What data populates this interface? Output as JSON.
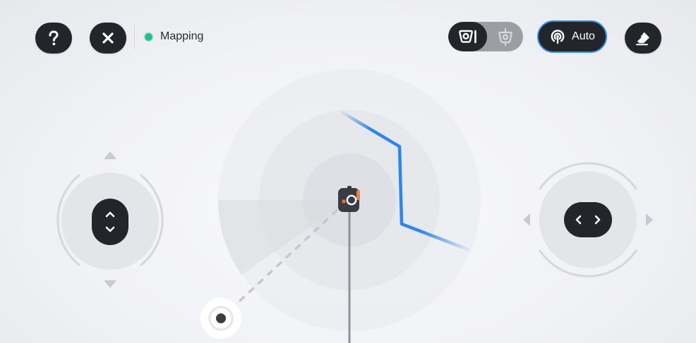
{
  "toolbar": {
    "help_icon": "question-mark-icon",
    "close_icon": "close-icon",
    "status": {
      "label": "Mapping",
      "color": "#22c08c"
    },
    "camera_toggle": {
      "active": "camera-icon",
      "inactive": "robot-icon"
    },
    "mode_button": {
      "label": "Auto",
      "icon": "signal-icon",
      "accent": "#2f8cf0"
    },
    "eraser_icon": "eraser-icon"
  },
  "controls": {
    "vertical_joystick": {
      "icons": [
        "chevron-up-icon",
        "chevron-down-icon"
      ]
    },
    "horizontal_joystick": {
      "icons": [
        "chevron-left-icon",
        "chevron-right-icon"
      ]
    }
  },
  "map": {
    "path_color": "#2a86f5",
    "robot_icon": "robot-icon",
    "target_icon": "target-marker-icon"
  }
}
